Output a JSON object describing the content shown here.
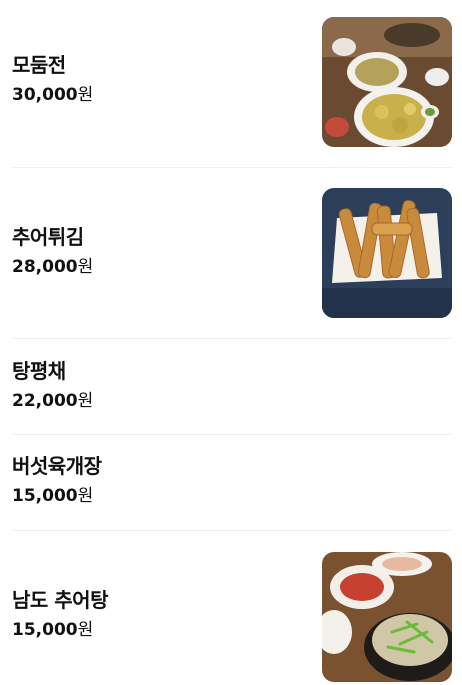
{
  "menu": {
    "currency_unit": "원",
    "items": [
      {
        "name": "모둠전",
        "price": "30,000",
        "has_photo": true
      },
      {
        "name": "추어튀김",
        "price": "28,000",
        "has_photo": true
      },
      {
        "name": "탕평채",
        "price": "22,000",
        "has_photo": false
      },
      {
        "name": "버섯육개장",
        "price": "15,000",
        "has_photo": false
      },
      {
        "name": "남도 추어탕",
        "price": "15,000",
        "has_photo": true
      }
    ]
  }
}
